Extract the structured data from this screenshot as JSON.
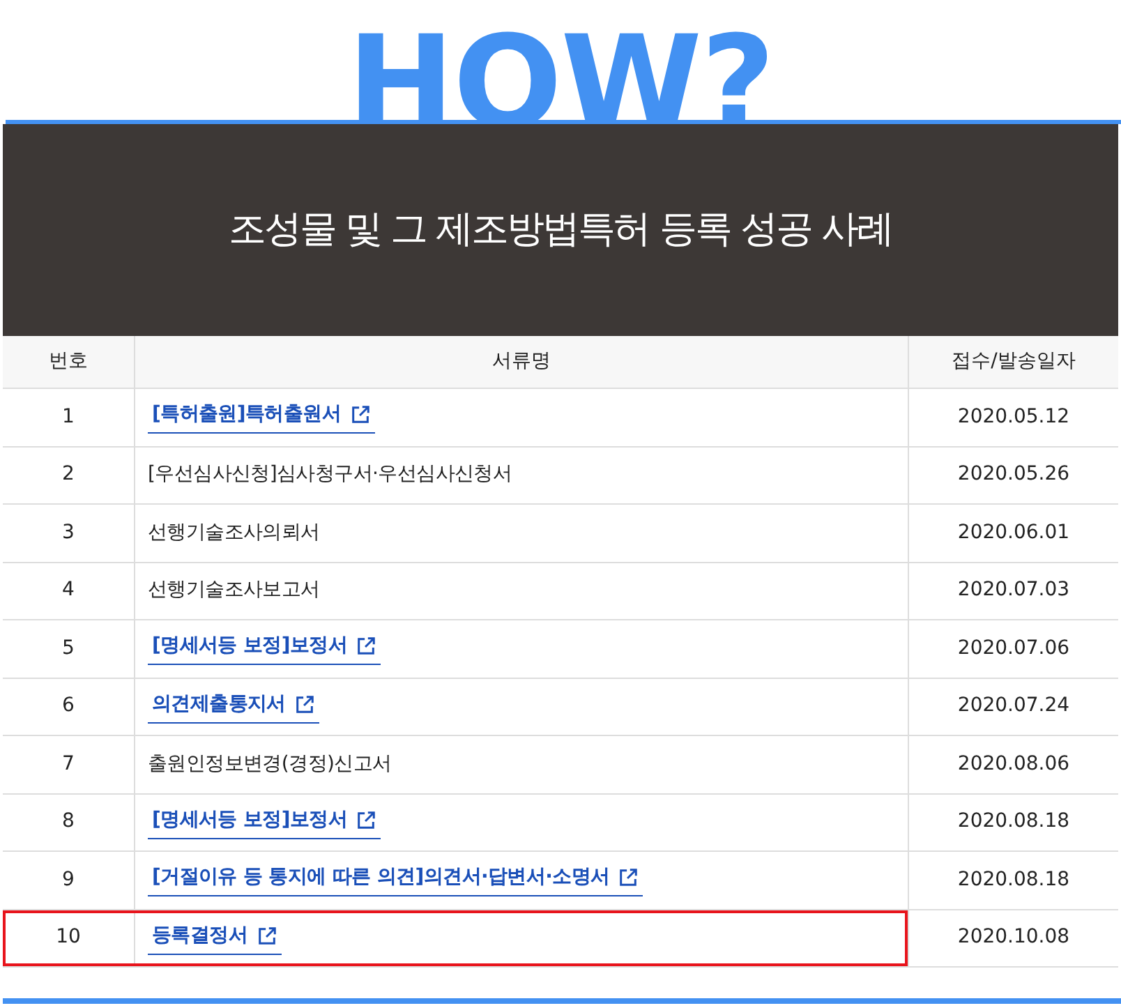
{
  "hero": {
    "heading": "HOW?",
    "title": "조성물 및 그 제조방법특허 등록 성공 사례"
  },
  "table": {
    "columns": [
      "번호",
      "서류명",
      "접수/발송일자"
    ],
    "rows": [
      {
        "number": "1",
        "document": "[특허출원]특허출원서",
        "kind": "link",
        "date": "2020.05.12",
        "highlighted": false
      },
      {
        "number": "2",
        "document": "[우선심사신청]심사청구서·우선심사신청서",
        "kind": "plain",
        "date": "2020.05.26",
        "highlighted": false
      },
      {
        "number": "3",
        "document": "선행기술조사의뢰서",
        "kind": "plain",
        "date": "2020.06.01",
        "highlighted": false
      },
      {
        "number": "4",
        "document": "선행기술조사보고서",
        "kind": "plain",
        "date": "2020.07.03",
        "highlighted": false
      },
      {
        "number": "5",
        "document": "[명세서등 보정]보정서",
        "kind": "link",
        "date": "2020.07.06",
        "highlighted": false
      },
      {
        "number": "6",
        "document": "의견제출통지서",
        "kind": "link",
        "date": "2020.07.24",
        "highlighted": false
      },
      {
        "number": "7",
        "document": "출원인정보변경(경정)신고서",
        "kind": "plain",
        "date": "2020.08.06",
        "highlighted": false
      },
      {
        "number": "8",
        "document": "[명세서등 보정]보정서",
        "kind": "link",
        "date": "2020.08.18",
        "highlighted": false
      },
      {
        "number": "9",
        "document": "[거절이유 등 통지에 따른 의견]의견서·답변서·소명서",
        "kind": "link",
        "date": "2020.08.18",
        "highlighted": false
      },
      {
        "number": "10",
        "document": "등록결정서",
        "kind": "link",
        "date": "2020.10.08",
        "highlighted": true
      }
    ]
  }
}
